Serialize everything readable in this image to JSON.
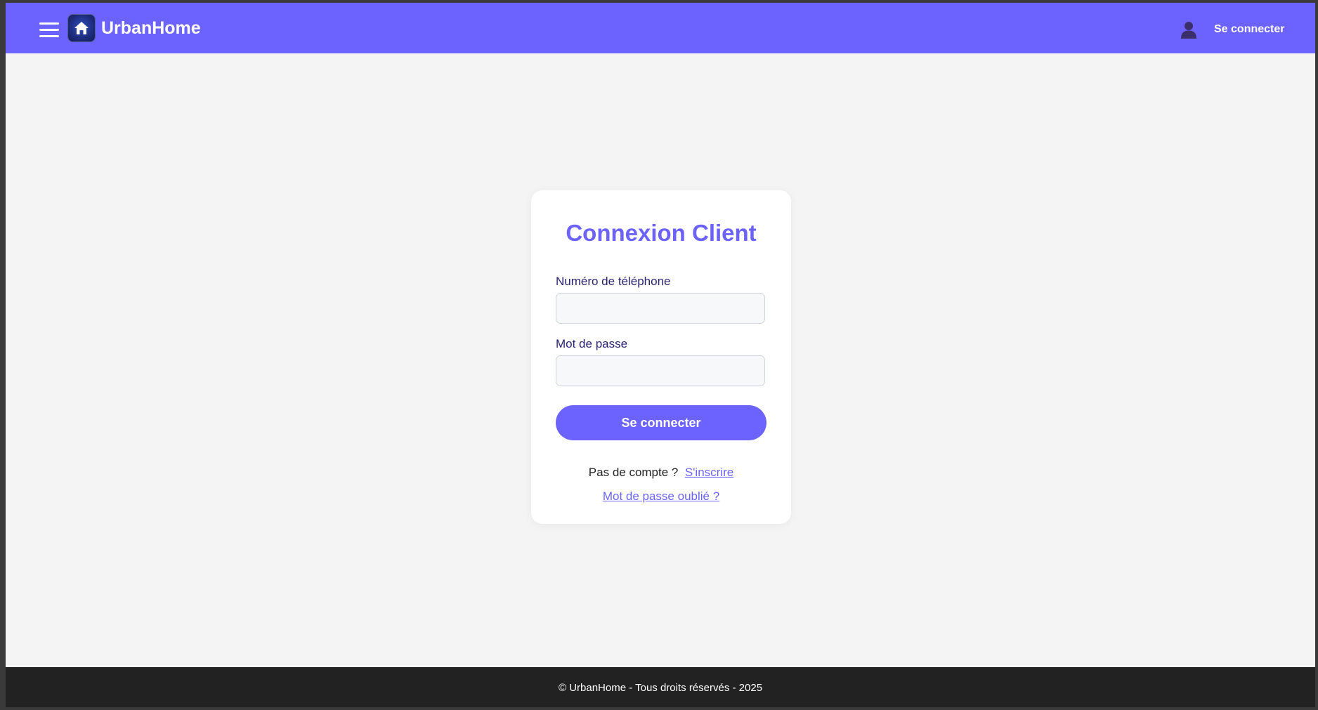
{
  "header": {
    "brand": "UrbanHome",
    "login_label": "Se connecter",
    "icons": {
      "menu": "hamburger-menu-icon",
      "logo": "home-icon",
      "user": "user-icon"
    }
  },
  "login_card": {
    "title": "Connexion Client",
    "phone_label": "Numéro de téléphone",
    "phone_value": "",
    "password_label": "Mot de passe",
    "password_value": "",
    "submit_label": "Se connecter",
    "no_account_text": "Pas de compte ?",
    "signup_link": "S'inscrire",
    "forgot_link": "Mot de passe oublié ?"
  },
  "footer": {
    "text": "© UrbanHome - Tous droits réservés - 2025"
  },
  "colors": {
    "primary": "#6c63ff",
    "background": "#f4f4f4",
    "footer": "#222222",
    "label": "#2a2470"
  }
}
